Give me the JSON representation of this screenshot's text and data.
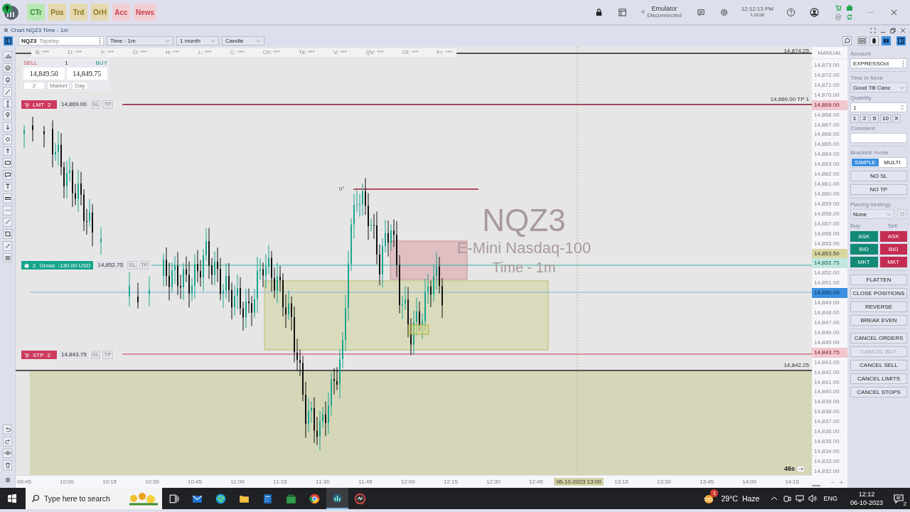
{
  "top_bar": {
    "modules": [
      {
        "label": "CTr",
        "kind": "green"
      },
      {
        "label": "Pos",
        "kind": "tan"
      },
      {
        "label": "Trd",
        "kind": "tan"
      },
      {
        "label": "OrH",
        "kind": "tan"
      },
      {
        "label": "Acc",
        "kind": "pink"
      },
      {
        "label": "News",
        "kind": "pink"
      }
    ],
    "connection": {
      "name": "Emulator",
      "status": "Disconnected",
      "connected": false
    },
    "clock": {
      "time": "12:12:13 PM",
      "zone": "Local"
    }
  },
  "window": {
    "title": "Chart NQZ3 Time - 1m"
  },
  "toolbar": {
    "symbol": "NQZ3",
    "symbol_note": "Topstep",
    "dropdowns": [
      "Time - 1m",
      "1 month",
      "Candle"
    ]
  },
  "chart": {
    "header_fields": [
      "B: ***",
      "D: ***",
      "Y: ***",
      "O: ***",
      "H: ***",
      "L: ***",
      "C: ***",
      "Ch: ***",
      "Tk: ***",
      "V: ***",
      "QV: ***",
      "OI: ***",
      "Fr: ***"
    ],
    "quote": {
      "sell_label": "SELL",
      "quantity": "1",
      "buy_label": "BUY",
      "bid": "14,849.50",
      "ask": "14,849.75",
      "order_size": "2",
      "order_type": "Market",
      "duration": "Day"
    },
    "watermark": [
      "NQZ3",
      "E-Mini Nasdaq-100",
      "Time - 1m"
    ],
    "orders": [
      {
        "kind": "limit",
        "label": "LMT",
        "quantity": "2",
        "price": "14,869.00",
        "sl": "SL",
        "tp": "TP"
      },
      {
        "kind": "position",
        "label": "Gross: -130.00 USD",
        "quantity": "2",
        "price": "14,852.75",
        "sl": "SL",
        "tp": "TP"
      },
      {
        "kind": "stop",
        "label": "STP",
        "quantity": "2",
        "price": "14,843.75",
        "sl": "SL",
        "tp": "TP"
      }
    ],
    "line_labels": [
      {
        "kind": "high",
        "text": "14,874.25"
      },
      {
        "kind": "target",
        "text": "14,869.00 TP 1"
      },
      {
        "kind": "low",
        "text": "14,842.25"
      }
    ],
    "drawing_label": "0°",
    "countdown": "46s",
    "price_axis": {
      "mode": "MANUAL",
      "labels": [
        {
          "text": "14,873.00",
          "kind": "tick"
        },
        {
          "text": "14,872.00",
          "kind": "tick"
        },
        {
          "text": "14,871.00",
          "kind": "tick"
        },
        {
          "text": "14,870.00",
          "kind": "tick"
        },
        {
          "text": "14,869.00",
          "kind": "limit"
        },
        {
          "text": "14,868.00",
          "kind": "tick"
        },
        {
          "text": "14,867.00",
          "kind": "tick"
        },
        {
          "text": "14,866.00",
          "kind": "tick"
        },
        {
          "text": "14,865.00",
          "kind": "tick"
        },
        {
          "text": "14,864.00",
          "kind": "tick"
        },
        {
          "text": "14,863.00",
          "kind": "tick"
        },
        {
          "text": "14,862.00",
          "kind": "tick"
        },
        {
          "text": "14,861.00",
          "kind": "tick"
        },
        {
          "text": "14,860.00",
          "kind": "tick"
        },
        {
          "text": "14,859.00",
          "kind": "tick"
        },
        {
          "text": "14,858.00",
          "kind": "tick"
        },
        {
          "text": "14,857.00",
          "kind": "tick"
        },
        {
          "text": "14,856.00",
          "kind": "tick"
        },
        {
          "text": "14,855.00",
          "kind": "tick"
        },
        {
          "text": "14,853.50",
          "kind": "last"
        },
        {
          "text": "14,852.75",
          "kind": "position"
        },
        {
          "text": "14,852.00",
          "kind": "tick"
        },
        {
          "text": "14,851.00",
          "kind": "tick"
        },
        {
          "text": "14,850.00",
          "kind": "current"
        },
        {
          "text": "14,849.00",
          "kind": "tick"
        },
        {
          "text": "14,848.00",
          "kind": "tick"
        },
        {
          "text": "14,847.00",
          "kind": "tick"
        },
        {
          "text": "14,846.00",
          "kind": "tick"
        },
        {
          "text": "14,845.00",
          "kind": "tick"
        },
        {
          "text": "14,843.75",
          "kind": "stop"
        },
        {
          "text": "14,843.00",
          "kind": "tick"
        },
        {
          "text": "14,842.00",
          "kind": "tick"
        },
        {
          "text": "14,841.00",
          "kind": "tick"
        },
        {
          "text": "14,840.00",
          "kind": "tick"
        },
        {
          "text": "14,839.00",
          "kind": "tick"
        },
        {
          "text": "14,838.00",
          "kind": "tick"
        },
        {
          "text": "14,837.00",
          "kind": "tick"
        },
        {
          "text": "14,836.00",
          "kind": "tick"
        },
        {
          "text": "14,835.00",
          "kind": "tick"
        },
        {
          "text": "14,834.00",
          "kind": "tick"
        },
        {
          "text": "14,833.00",
          "kind": "tick"
        },
        {
          "text": "14,832.00",
          "kind": "tick"
        }
      ]
    },
    "time_axis": {
      "labels": [
        {
          "text": "09:45",
          "kind": "tick"
        },
        {
          "text": "10:00",
          "kind": "tick"
        },
        {
          "text": "10:15",
          "kind": "tick"
        },
        {
          "text": "10:30",
          "kind": "tick"
        },
        {
          "text": "10:45",
          "kind": "tick"
        },
        {
          "text": "11:00",
          "kind": "tick"
        },
        {
          "text": "11:15",
          "kind": "tick"
        },
        {
          "text": "11:30",
          "kind": "tick"
        },
        {
          "text": "11:45",
          "kind": "tick"
        },
        {
          "text": "12:00",
          "kind": "tick"
        },
        {
          "text": "12:15",
          "kind": "tick"
        },
        {
          "text": "12:30",
          "kind": "tick"
        },
        {
          "text": "12:45",
          "kind": "tick"
        },
        {
          "text": "06-10-2023 13:00",
          "kind": "cursor"
        },
        {
          "text": "13:15",
          "kind": "tick"
        },
        {
          "text": "13:30",
          "kind": "tick"
        },
        {
          "text": "13:45",
          "kind": "tick"
        },
        {
          "text": "14:00",
          "kind": "tick"
        },
        {
          "text": "14:15",
          "kind": "tick"
        }
      ]
    }
  },
  "order_panel": {
    "account_label": "Account",
    "account": "EXPRESSOct",
    "tif_label": "Time in force",
    "tif": "Good Till Canc",
    "quantity_label": "Quantity",
    "quantity": "1",
    "quick_quantities": [
      "1",
      "2",
      "5",
      "10",
      "X"
    ],
    "comment_label": "Comment",
    "brackets_label": "Brackets mode",
    "brackets_modes": [
      {
        "label": "SIMPLE",
        "selected": true
      },
      {
        "label": "MULTI",
        "selected": false
      }
    ],
    "bracket_buttons": [
      "NO SL",
      "NO TP"
    ],
    "strategy_label": "Placing strategy",
    "strategy": "None",
    "buy_label": "Buy",
    "sell_label": "Sell",
    "trade_buttons": [
      {
        "buy": "ASK",
        "sell": "ASK"
      },
      {
        "buy": "BID",
        "sell": "BID"
      },
      {
        "buy": "MKT",
        "sell": "MKT"
      }
    ],
    "position_actions": [
      {
        "label": "FLATTEN",
        "disabled": false
      },
      {
        "label": "CLOSE POSITIONS",
        "disabled": false
      },
      {
        "label": "REVERSE",
        "disabled": false
      },
      {
        "label": "BREAK EVEN",
        "disabled": false
      }
    ],
    "cancel_actions": [
      {
        "label": "CANCEL ORDERS",
        "disabled": false
      },
      {
        "label": "CANCEL BUY",
        "disabled": true
      },
      {
        "label": "CANCEL SELL",
        "disabled": false
      },
      {
        "label": "CANCEL LIMITS",
        "disabled": false
      },
      {
        "label": "CANCEL STOPS",
        "disabled": false
      }
    ]
  },
  "taskbar": {
    "search_placeholder": "Type here to search",
    "weather": {
      "temperature": "29°C",
      "condition": "Haze",
      "badge": "1"
    },
    "language": "ENG",
    "time": "12:12",
    "date": "06-10-2023",
    "notifications": "2"
  }
}
